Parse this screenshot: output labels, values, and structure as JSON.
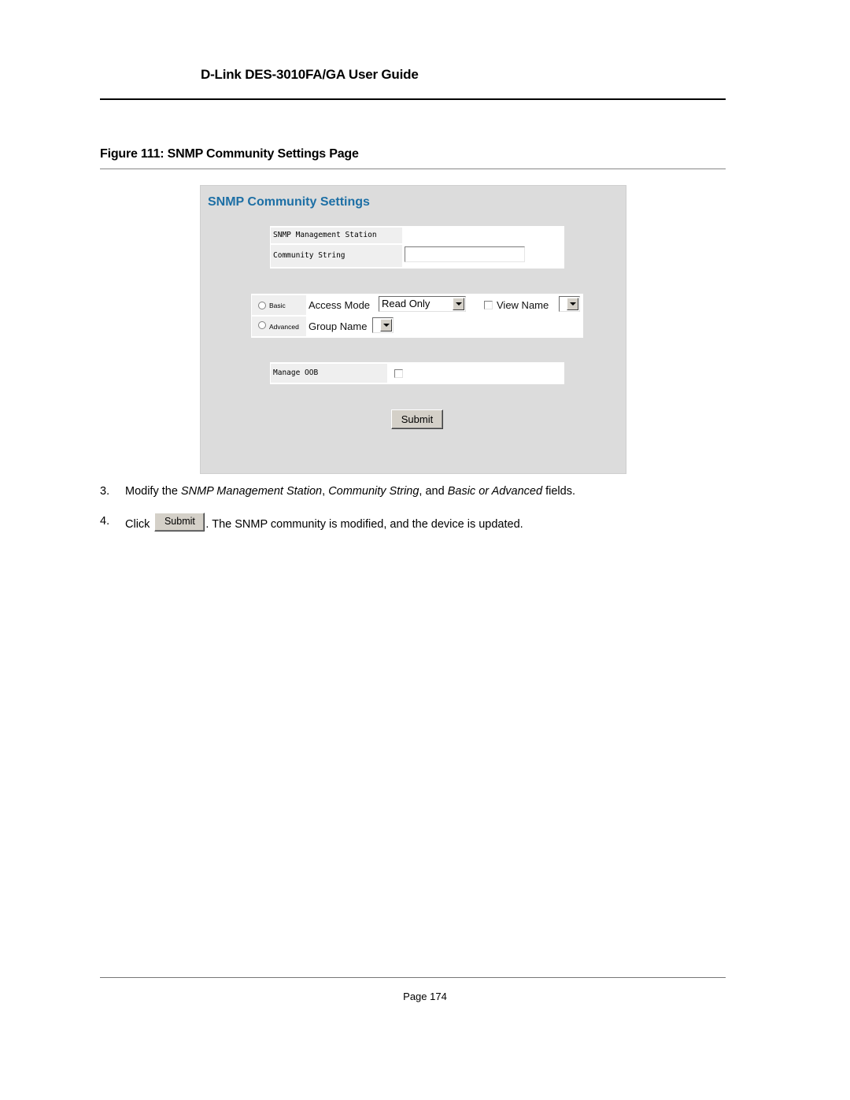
{
  "document": {
    "header": "D-Link DES-3010FA/GA User Guide",
    "figure_title": "Figure 111: SNMP Community Settings Page",
    "page_label": "Page 174"
  },
  "screenshot": {
    "title": "SNMP Community Settings",
    "colors": {
      "title": "#1d6fa5",
      "panel_bg": "#dcdcdc"
    },
    "fields": {
      "management_station_label": "SNMP Management Station",
      "management_station_value": "",
      "community_string_label": "Community String",
      "community_string_value": ""
    },
    "mode": {
      "basic_label": "Basic",
      "basic_selected": false,
      "advanced_label": "Advanced",
      "advanced_selected": false,
      "access_mode_label": "Access Mode",
      "access_mode_value": "Read Only",
      "view_name_label": "View Name",
      "view_name_checked": false,
      "view_name_value": "",
      "group_name_label": "Group Name",
      "group_name_value": ""
    },
    "oob": {
      "label": "Manage OOB",
      "checked": false
    },
    "submit_label": "Submit"
  },
  "steps": [
    {
      "number": "3.",
      "parts": [
        {
          "text": "Modify the ",
          "italic": false
        },
        {
          "text": "SNMP Management Station",
          "italic": true
        },
        {
          "text": ", ",
          "italic": false
        },
        {
          "text": "Community String",
          "italic": true
        },
        {
          "text": ", and ",
          "italic": false
        },
        {
          "text": "Basic or Advanced",
          "italic": true
        },
        {
          "text": " fields.",
          "italic": false
        }
      ]
    },
    {
      "number": "4.",
      "before": "Click",
      "button_label": "Submit",
      "after": ". The SNMP community is modified, and the device is updated."
    }
  ]
}
